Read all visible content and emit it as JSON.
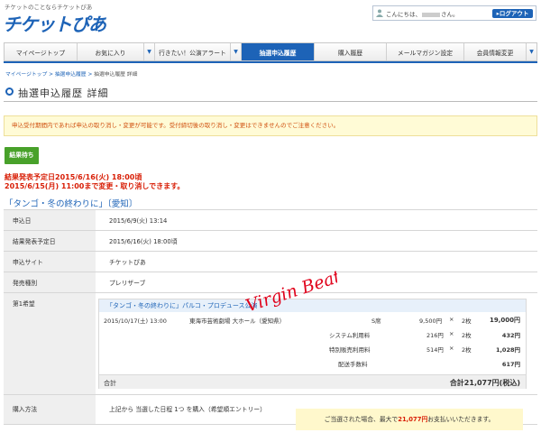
{
  "header": {
    "tagline": "チケットのことならチケットぴあ",
    "logo": "チケットぴあ",
    "greeting_prefix": "こんにちは、",
    "greeting_suffix": "さん。",
    "logout_label": "▸ログアウト"
  },
  "nav": {
    "items": [
      {
        "label": "マイページトップ",
        "dropdown": false
      },
      {
        "label": "お気に入り",
        "dropdown": true
      },
      {
        "label": "行きたい！公演アラート",
        "dropdown": true
      },
      {
        "label": "抽選申込履歴",
        "dropdown": false,
        "active": true
      },
      {
        "label": "購入履歴",
        "dropdown": false
      },
      {
        "label": "メールマガジン設定",
        "dropdown": false
      },
      {
        "label": "会員情報変更",
        "dropdown": true
      }
    ],
    "dropdown_glyph": "▼"
  },
  "breadcrumb": {
    "items": [
      "マイページトップ",
      "抽選申込履歴",
      "抽選申込履歴 詳細"
    ],
    "separator": " > "
  },
  "page_title": "抽選申込履歴 詳細",
  "notice": "申込受付期間内であれば申込の取り消し・変更が可能です。受付締切後の取り消し・変更はできませんのでご注意ください。",
  "status_badge": "結果待ち",
  "announcement": {
    "line1": "結果発表予定日2015/6/16(火) 18:00頃",
    "line2": "2015/6/15(月) 11:00まで変更・取り消しできます。"
  },
  "event_title": "「タンゴ・冬の終わりに」〔愛知〕",
  "details": [
    {
      "label": "申込日",
      "value": "2015/6/9(火) 13:14"
    },
    {
      "label": "結果発表予定日",
      "value": "2015/6/16(火) 18:00頃"
    },
    {
      "label": "申込サイト",
      "value": "チケットぴあ"
    },
    {
      "label": "発売種別",
      "value": "プレリザーブ"
    }
  ],
  "wish": {
    "label": "第1希望",
    "event_header": "「タンゴ・冬の終わりに」パルコ・プロデュース公演",
    "performance": {
      "datetime": "2015/10/17(土) 13:00",
      "venue": "東海市芸術劇場 大ホール（愛知県）",
      "seat": "S席",
      "unit_price": "9,500円",
      "times": "×",
      "qty": "2枚",
      "amount": "19,000円"
    },
    "fees": [
      {
        "label": "システム利用料",
        "unit_price": "216円",
        "qty": "2枚",
        "amount": "432円"
      },
      {
        "label": "特別販売利用料",
        "unit_price": "514円",
        "qty": "2枚",
        "amount": "1,028円"
      },
      {
        "label": "配送手数料",
        "unit_price": "",
        "qty": "",
        "amount": "617円"
      }
    ],
    "total_label": "合計",
    "total_value": "合計21,077円(税込)"
  },
  "purchase": {
    "label": "購入方法",
    "method": "上記から 当選した日程 1つ を購入（希望順エントリー）",
    "note_prefix": "ご当選された場合、最大で",
    "note_amount": "21,077円",
    "note_suffix": "お支払いいただきます。"
  },
  "watermark_text": "Virgin Beat",
  "colors": {
    "brand_blue": "#1d63b7",
    "status_green": "#48a12a",
    "alert_red": "#d81e06",
    "notice_bg": "#fffbd6"
  }
}
